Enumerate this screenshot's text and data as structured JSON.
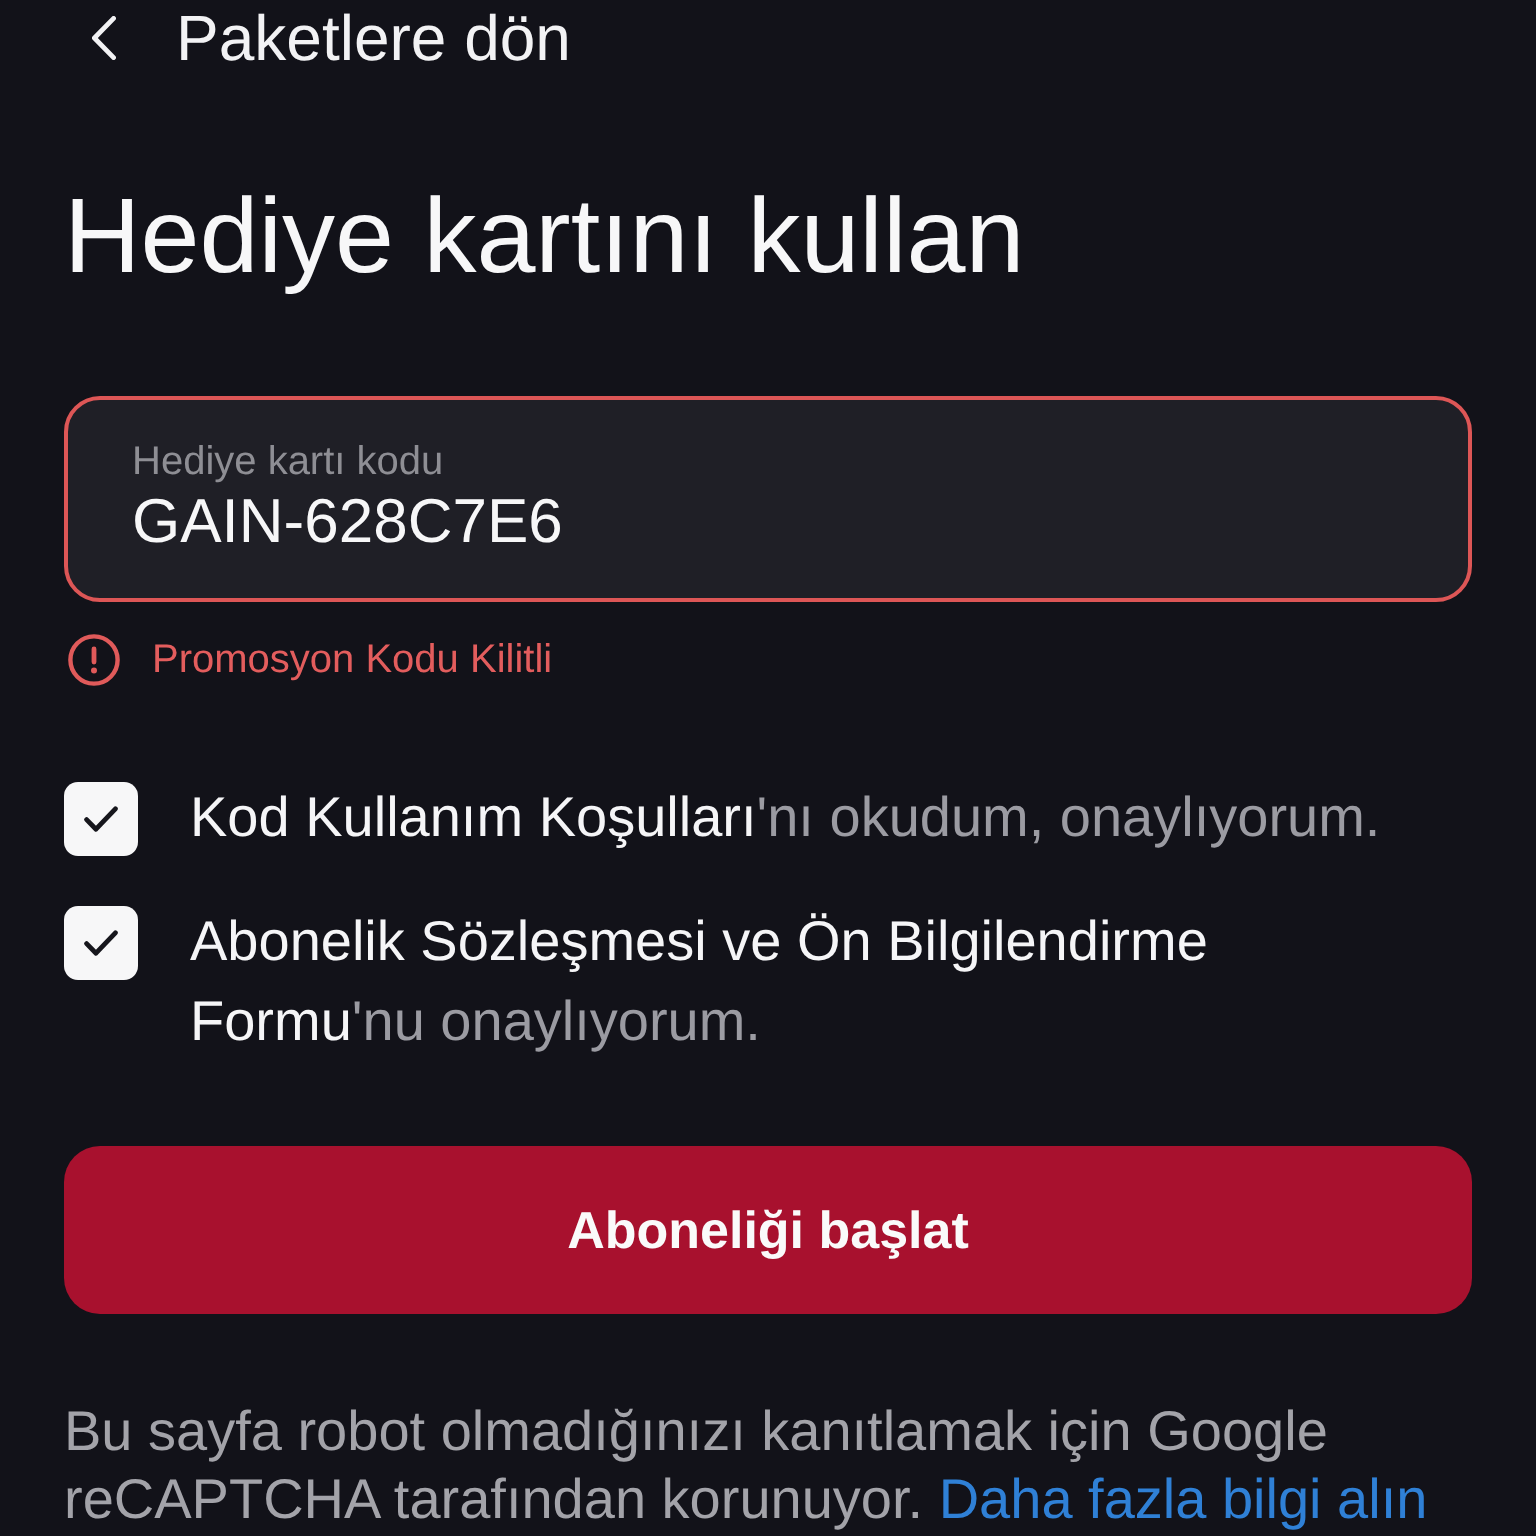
{
  "back_link": {
    "label": "Paketlere dön"
  },
  "title": "Hediye kartını kullan",
  "code_field": {
    "label": "Hediye kartı kodu",
    "value": "GAIN-628C7E6",
    "invalid": true
  },
  "error_message": "Promosyon Kodu Kilitli",
  "consents": [
    {
      "highlight": "Kod Kullanım Koşulları",
      "text": "'nı okudum, onaylıyorum.",
      "checked": true
    },
    {
      "highlight": "Abonelik Sözleşmesi ve Ön Bilgilendirme Formu",
      "text": "'nu onaylıyorum.",
      "checked": true
    }
  ],
  "submit_button": {
    "label": "Aboneliği başlat"
  },
  "recaptcha_notice": {
    "text": "Bu sayfa robot olmadığınızı kanıtlamak için Google reCAPTCHA tarafından korunuyor.",
    "link": "Daha fazla bilgi alın"
  }
}
